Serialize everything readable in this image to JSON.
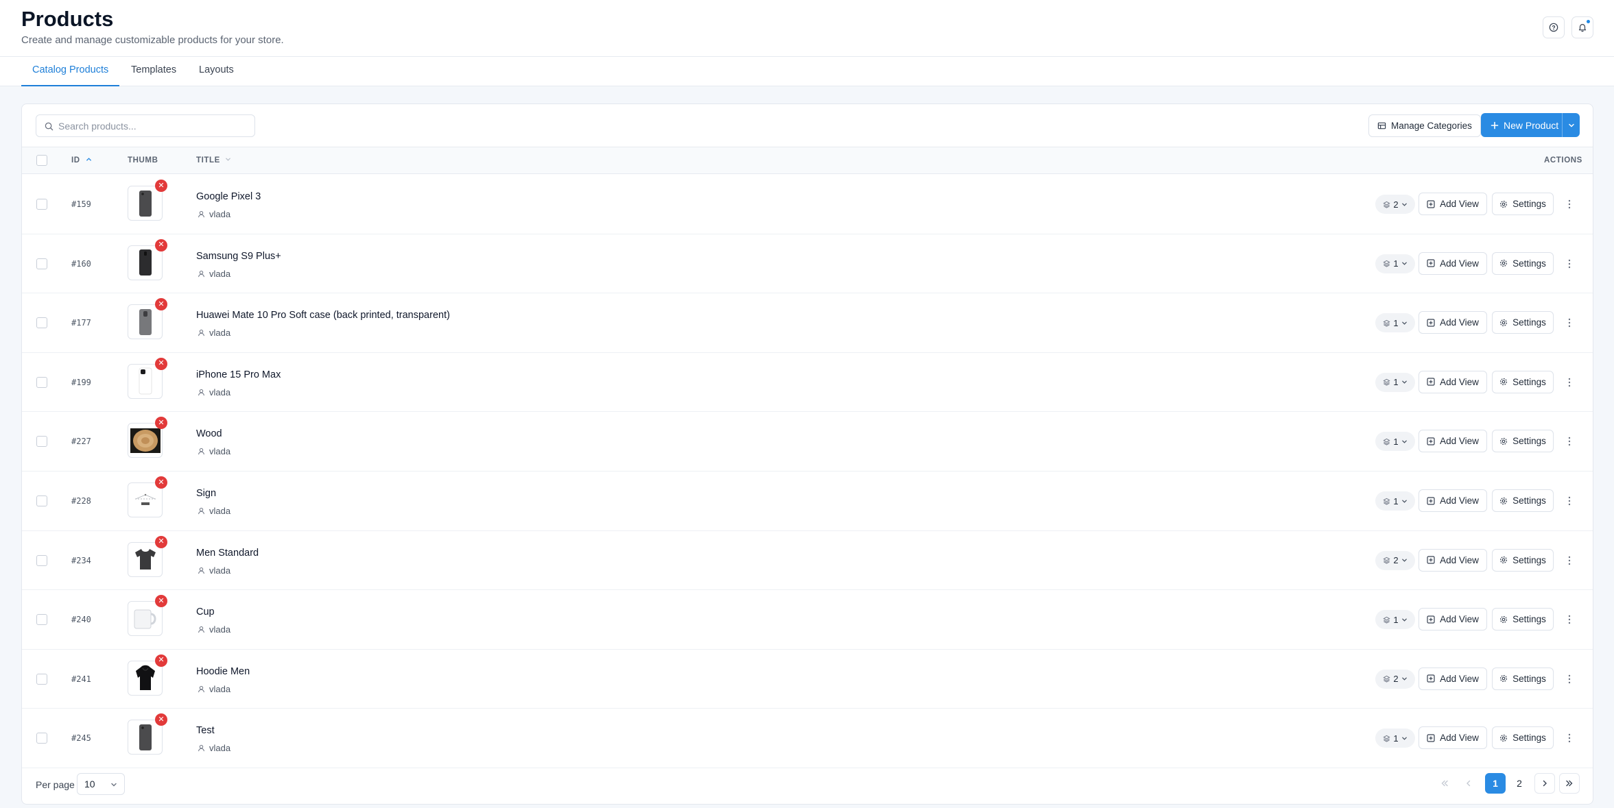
{
  "header": {
    "title": "Products",
    "subtitle": "Create and manage customizable products for your store."
  },
  "tabs": [
    {
      "label": "Catalog Products",
      "active": true
    },
    {
      "label": "Templates",
      "active": false
    },
    {
      "label": "Layouts",
      "active": false
    }
  ],
  "toolbar": {
    "search_placeholder": "Search products...",
    "manage_categories_label": "Manage Categories",
    "new_product_label": "New Product"
  },
  "table": {
    "columns": {
      "id": "ID",
      "thumb": "THUMB",
      "title": "TITLE",
      "actions": "ACTIONS"
    },
    "add_view_label": "Add View",
    "settings_label": "Settings",
    "rows": [
      {
        "id": "#159",
        "title": "Google Pixel 3",
        "owner": "vlada",
        "views": "2",
        "thumb": "phone-dark"
      },
      {
        "id": "#160",
        "title": "Samsung S9 Plus+",
        "owner": "vlada",
        "views": "1",
        "thumb": "phone-black"
      },
      {
        "id": "#177",
        "title": "Huawei Mate 10 Pro Soft case (back printed, transparent)",
        "owner": "vlada",
        "views": "1",
        "thumb": "phone-grey"
      },
      {
        "id": "#199",
        "title": "iPhone 15 Pro Max",
        "owner": "vlada",
        "views": "1",
        "thumb": "phone-white"
      },
      {
        "id": "#227",
        "title": "Wood",
        "owner": "vlada",
        "views": "1",
        "thumb": "wood-disc"
      },
      {
        "id": "#228",
        "title": "Sign",
        "owner": "vlada",
        "views": "1",
        "thumb": "sign"
      },
      {
        "id": "#234",
        "title": "Men Standard",
        "owner": "vlada",
        "views": "2",
        "thumb": "tshirt"
      },
      {
        "id": "#240",
        "title": "Cup",
        "owner": "vlada",
        "views": "1",
        "thumb": "mug"
      },
      {
        "id": "#241",
        "title": "Hoodie Men",
        "owner": "vlada",
        "views": "2",
        "thumb": "hoodie"
      },
      {
        "id": "#245",
        "title": "Test",
        "owner": "vlada",
        "views": "1",
        "thumb": "phone-dark"
      }
    ]
  },
  "pagination": {
    "per_page_label": "Per page",
    "per_page_value": "10",
    "pages": [
      "1",
      "2"
    ],
    "current_page": "1"
  },
  "colors": {
    "accent": "#2a8be3",
    "remove": "#e23a3a"
  }
}
